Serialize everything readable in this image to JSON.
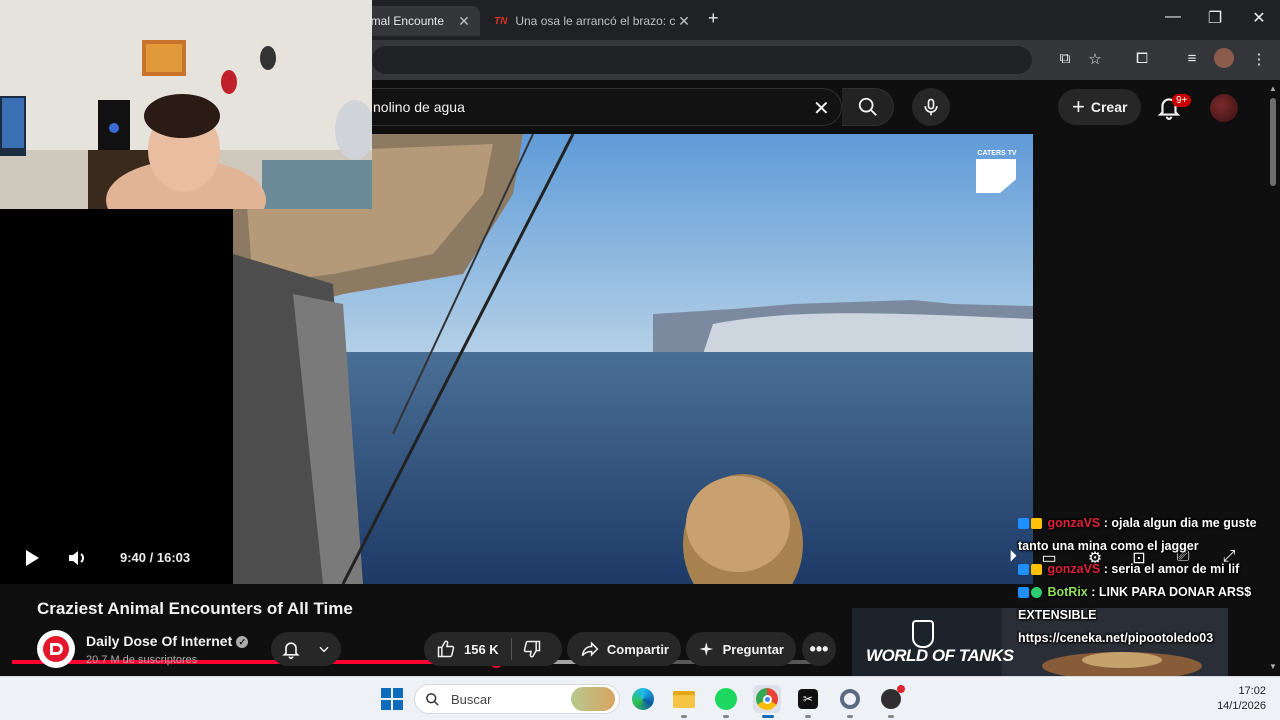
{
  "browser": {
    "tabs": [
      {
        "label": "imal Encounte",
        "active": true
      },
      {
        "label": "Una osa le arrancó el brazo: cóm",
        "active": false
      }
    ],
    "tab_logo_text": "TN",
    "icons": [
      "close-icon",
      "new-tab-icon",
      "minimize-icon",
      "maximize-icon",
      "window-close-icon",
      "install-icon",
      "bookmark-star-icon",
      "extensions-icon",
      "media-icon",
      "profile-icon",
      "menu-icon"
    ]
  },
  "youtube": {
    "search_value": "nolino de agua",
    "create_label": "Crear",
    "notifications_badge": "9+"
  },
  "player": {
    "watermark": "CATERS TV",
    "current_time": "9:40",
    "duration": "16:03",
    "time_display": "9:40 / 16:03",
    "progress_fraction": 0.6025,
    "buffer_fraction": 0.75
  },
  "video_info": {
    "title": "Craziest Animal Encounters of All Time",
    "channel": "Daily Dose Of Internet",
    "subscribers": "20.7 M de suscriptores",
    "likes": "156 K",
    "share_label": "Compartir",
    "ask_label": "Preguntar"
  },
  "ad": {
    "brand": "WORLD OF TANKS"
  },
  "chat": [
    {
      "user": "gonzaVS",
      "user_color": "#e0233a",
      "text": ": ojala algun dia me guste tanto una mina como el jagger"
    },
    {
      "user": "gonzaVS",
      "user_color": "#e0233a",
      "text": ": seria el amor de mi lif"
    },
    {
      "user": "BotRix",
      "user_color": "#8fe05a",
      "text": ": LINK PARA DONAR ARS$ EXTENSIBLE https://ceneka.net/pipootoledo03"
    }
  ],
  "taskbar": {
    "search_placeholder": "Buscar",
    "time": "17:02",
    "date": "14/1/2026"
  },
  "colors": {
    "youtube_red": "#ff0033",
    "chrome_dark": "#202124",
    "yt_bg": "#0f0f0f"
  }
}
